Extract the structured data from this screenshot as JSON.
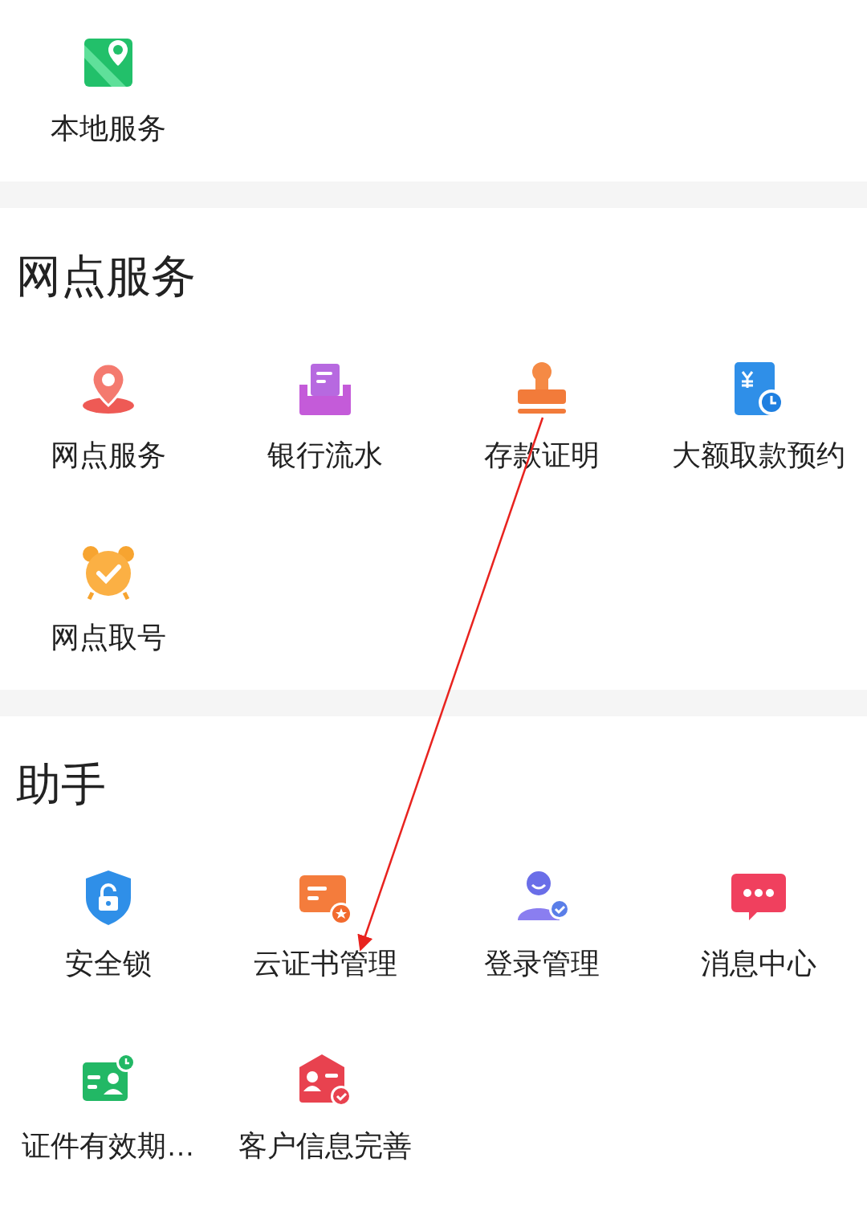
{
  "sections": [
    {
      "items": [
        {
          "label": "本地服务",
          "kind": "map"
        }
      ]
    },
    {
      "title": "网点服务",
      "items": [
        {
          "label": "网点服务",
          "kind": "location"
        },
        {
          "label": "银行流水",
          "kind": "receipt"
        },
        {
          "label": "存款证明",
          "kind": "stamp"
        },
        {
          "label": "大额取款预约",
          "kind": "bill-clock"
        },
        {
          "label": "网点取号",
          "kind": "alarm"
        }
      ]
    },
    {
      "title": "助手",
      "items": [
        {
          "label": "安全锁",
          "kind": "shield-lock"
        },
        {
          "label": "云证书管理",
          "kind": "certificate"
        },
        {
          "label": "登录管理",
          "kind": "user-check"
        },
        {
          "label": "消息中心",
          "kind": "chat"
        },
        {
          "label": "证件有效期…",
          "kind": "id-clock"
        },
        {
          "label": "客户信息完善",
          "kind": "id-check"
        }
      ]
    }
  ]
}
